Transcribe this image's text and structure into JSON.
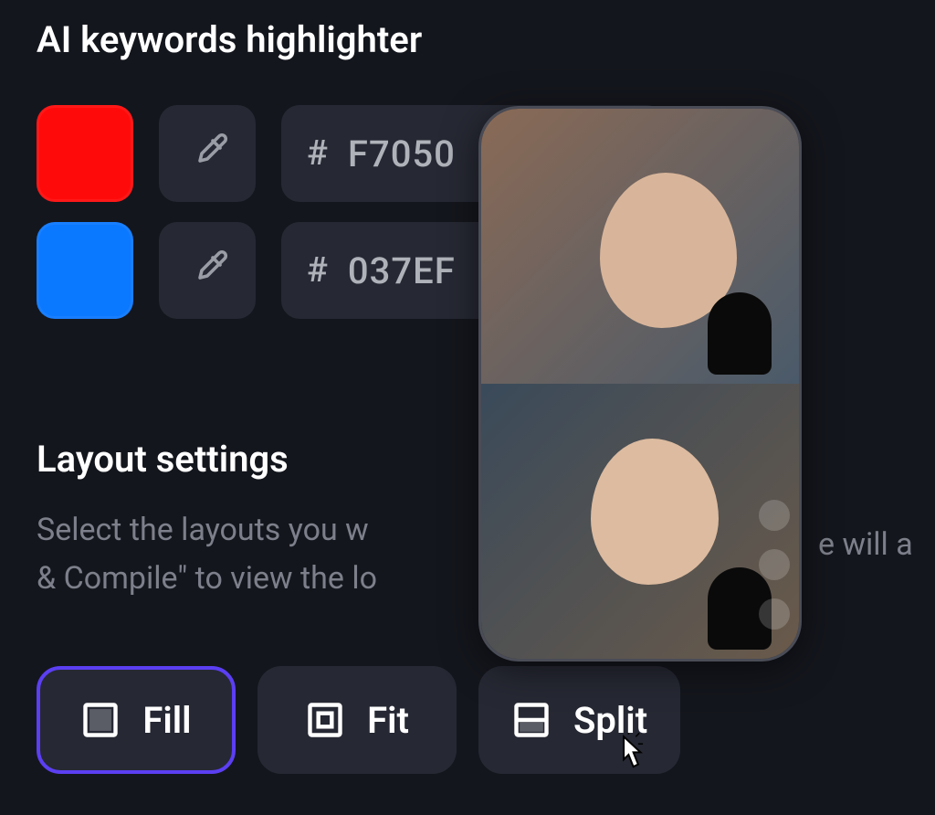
{
  "highlighter": {
    "title": "AI keywords highlighter",
    "colors": [
      {
        "swatch": "#ff0a0a",
        "hex": "F7050"
      },
      {
        "swatch": "#0a78ff",
        "hex": "037EF"
      }
    ],
    "hash": "#"
  },
  "layout": {
    "title": "Layout settings",
    "description_part1": "Select the layouts you w",
    "description_part2": "& Compile\" to view the lo",
    "trailing_fragment": "e will a",
    "buttons": [
      {
        "label": "Fill",
        "icon": "fill",
        "active": true
      },
      {
        "label": "Fit",
        "icon": "fit",
        "active": false
      },
      {
        "label": "Split",
        "icon": "split",
        "active": false
      }
    ]
  },
  "preview": {
    "side_icons": [
      "heart",
      "comment",
      "share"
    ]
  }
}
